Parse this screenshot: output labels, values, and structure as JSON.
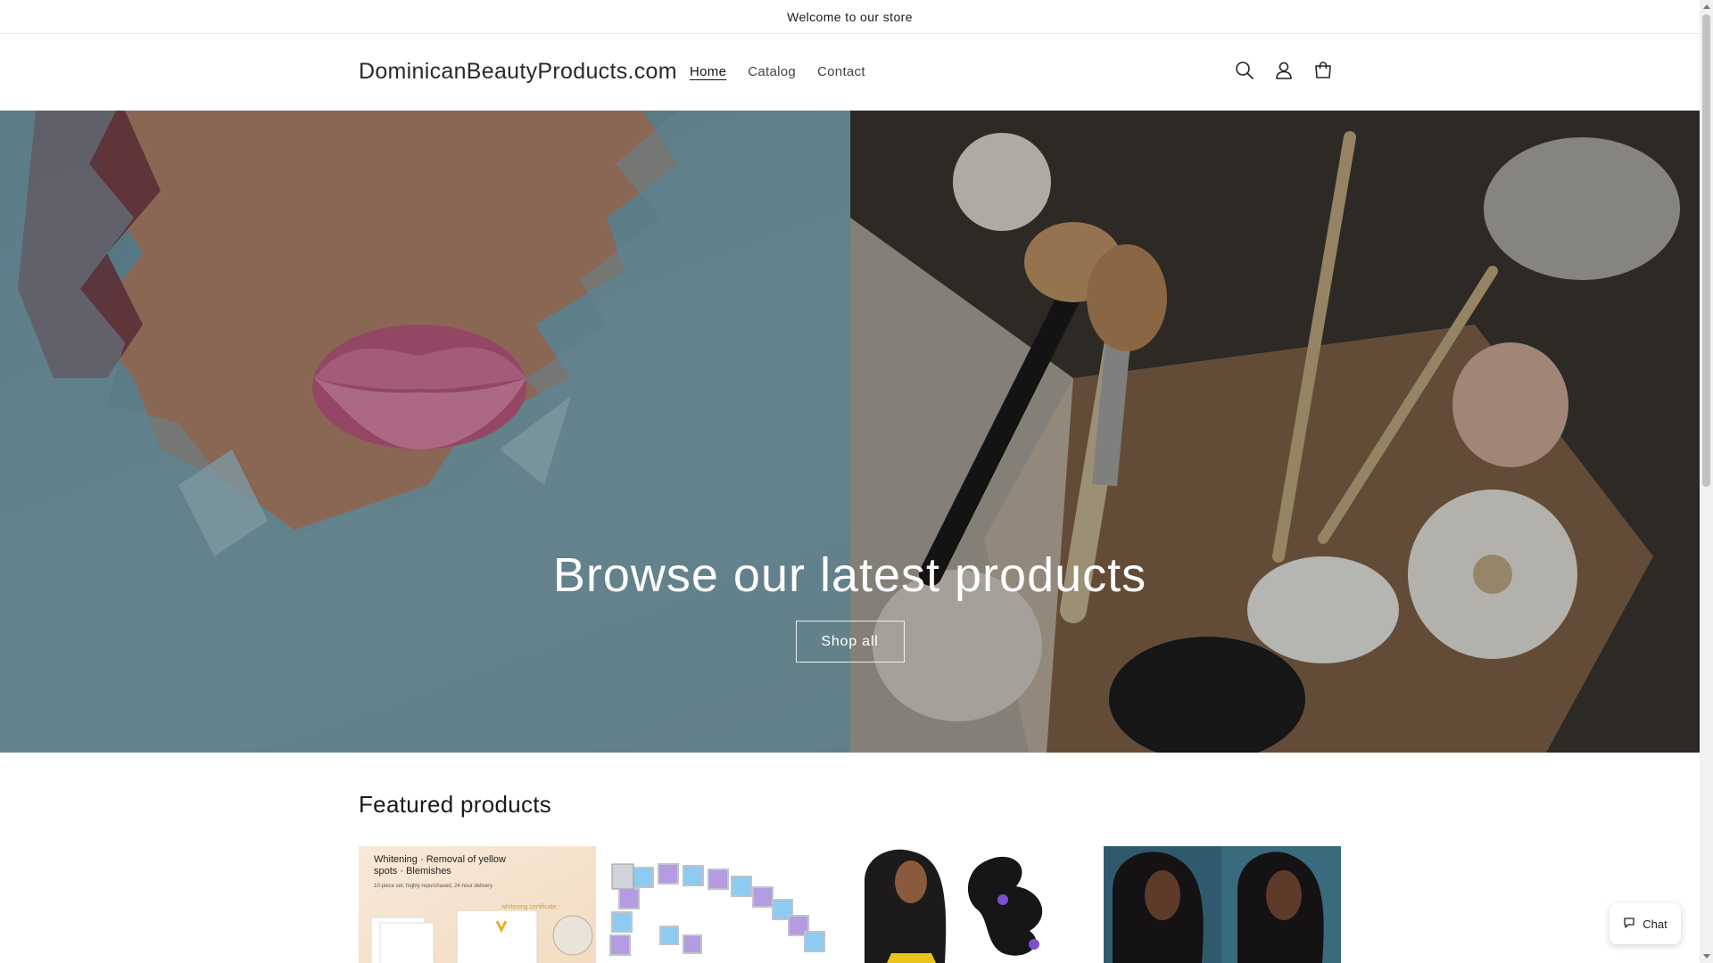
{
  "announcement": {
    "text": "Welcome to our store"
  },
  "header": {
    "logo": "DominicanBeautyProducts.com",
    "nav": [
      {
        "label": "Home",
        "active": true
      },
      {
        "label": "Catalog",
        "active": false
      },
      {
        "label": "Contact",
        "active": false
      }
    ],
    "icons": [
      "search-icon",
      "account-icon",
      "cart-icon"
    ]
  },
  "hero": {
    "title": "Browse our latest products",
    "button_label": "Shop all"
  },
  "featured": {
    "title": "Featured products",
    "products": [
      {
        "image_text_1": "Whitening · Removal of yellow",
        "image_text_2": "spots · Blemishes",
        "image_text_3": "10-piece set, highly repurchased, 24-hour delivery",
        "image_text_4": "whitening certificate"
      },
      {},
      {},
      {}
    ]
  },
  "chat": {
    "label": "Chat"
  },
  "colors": {
    "text": "#121212",
    "hero_overlay": "#000000",
    "accent": "#ffffff"
  }
}
